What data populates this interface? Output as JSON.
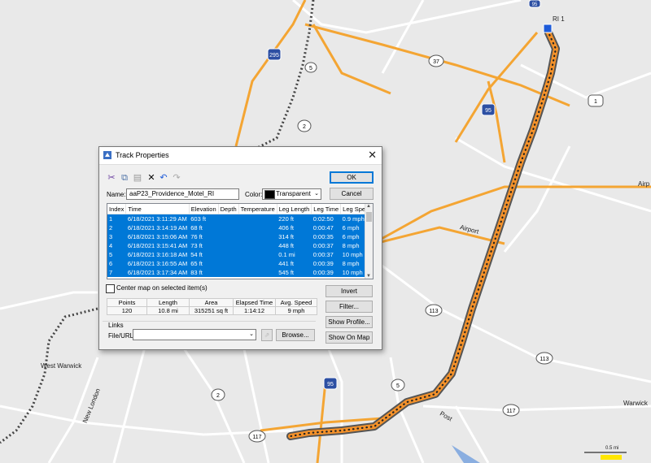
{
  "map": {
    "route_shields": [
      "295",
      "37",
      "95",
      "1",
      "2",
      "5",
      "5",
      "2",
      "113",
      "113",
      "117",
      "95",
      "117",
      "95"
    ],
    "labels": {
      "ri1": "RI 1",
      "airport_road_1": "Airport",
      "airport_road_2": "Airport",
      "airport_right": "Airp",
      "west_warwick": "West Warwick",
      "new_london": "New London",
      "warwick": "Warwick",
      "post": "Post",
      "scale": "0.5 mi"
    },
    "colors": {
      "background": "#e9e9e9",
      "major_road": "#f4a533",
      "minor_road": "#ffffff",
      "track_fill": "#f5922a",
      "track_outline": "#555555"
    }
  },
  "dialog": {
    "title": "Track Properties",
    "close_glyph": "✕",
    "toolbar": [
      "cut-icon",
      "copy-icon",
      "paste-icon",
      "delete-icon",
      "undo-icon",
      "redo-icon"
    ],
    "name_label": "Name:",
    "name_value": "aaP23_Providence_Motel_RI",
    "color_label": "Color:",
    "color_value": "Transparent",
    "ok_label": "OK",
    "cancel_label": "Cancel",
    "table": {
      "headers": [
        "Index",
        "Time",
        "Elevation",
        "Depth",
        "Temperature",
        "Leg Length",
        "Leg Time",
        "Leg Speed"
      ],
      "rows": [
        [
          "1",
          "6/18/2021 3:11:29 AM",
          "603 ft",
          "",
          "",
          "220 ft",
          "0:02:50",
          "0.9 mph"
        ],
        [
          "2",
          "6/18/2021 3:14:19 AM",
          "68 ft",
          "",
          "",
          "406 ft",
          "0:00:47",
          "6 mph"
        ],
        [
          "3",
          "6/18/2021 3:15:06 AM",
          "76 ft",
          "",
          "",
          "314 ft",
          "0:00:35",
          "6 mph"
        ],
        [
          "4",
          "6/18/2021 3:15:41 AM",
          "73 ft",
          "",
          "",
          "448 ft",
          "0:00:37",
          "8 mph"
        ],
        [
          "5",
          "6/18/2021 3:16:18 AM",
          "54 ft",
          "",
          "",
          "0.1 mi",
          "0:00:37",
          "10 mph"
        ],
        [
          "6",
          "6/18/2021 3:16:55 AM",
          "65 ft",
          "",
          "",
          "441 ft",
          "0:00:39",
          "8 mph"
        ],
        [
          "7",
          "6/18/2021 3:17:34 AM",
          "83 ft",
          "",
          "",
          "545 ft",
          "0:00:39",
          "10 mph"
        ]
      ]
    },
    "center_label": "Center map on selected item(s)",
    "stats": {
      "headers": [
        "Points",
        "Length",
        "Area",
        "Elapsed Time",
        "Avg. Speed"
      ],
      "values": [
        "120",
        "10.8 mi",
        "315251 sq ft",
        "1:14:12",
        "9 mph"
      ]
    },
    "links_label": "Links",
    "file_url_label": "File/URL:",
    "browse_label": "Browse...",
    "invert_label": "Invert",
    "filter_label": "Filter...",
    "show_profile_label": "Show Profile...",
    "show_on_map_label": "Show On Map"
  }
}
